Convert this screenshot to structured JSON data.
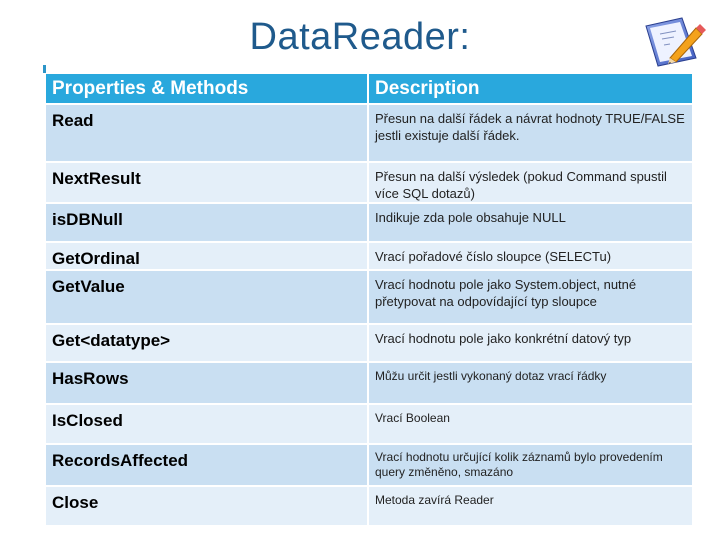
{
  "slide": {
    "title": "DataReader:",
    "icon": "notepad-pencil-icon"
  },
  "table": {
    "headers": [
      "Properties & Methods",
      "Description"
    ],
    "rows": [
      {
        "name": "Read",
        "description": "Přesun na další řádek a návrat hodnoty TRUE/FALSE jestli existuje další řádek."
      },
      {
        "name": "NextResult",
        "description": "Přesun na další výsledek (pokud Command spustil více SQL dotazů)"
      },
      {
        "name": "isDBNull",
        "description": "Indikuje zda pole obsahuje NULL"
      },
      {
        "name": "GetOrdinal",
        "description": "Vrací pořadové číslo sloupce (SELECTu)"
      },
      {
        "name": "GetValue",
        "description": "Vrací hodnotu pole jako System.object, nutné přetypovat na odpovídající typ sloupce"
      },
      {
        "name": "Get<datatype>",
        "description": "Vrací hodnotu pole jako konkrétní datový typ"
      },
      {
        "name": "HasRows",
        "description": "Můžu určit jestli vykonaný dotaz vrací řádky"
      },
      {
        "name": "IsClosed",
        "description": "Vrací Boolean"
      },
      {
        "name": "RecordsAffected",
        "description": "Vrací hodnotu určující kolik záznamů bylo provedením query změněno, smazáno"
      },
      {
        "name": "Close",
        "description": "Metoda zavírá Reader"
      }
    ]
  },
  "colors": {
    "title": "#1f5a8c",
    "header_bg": "#29a8dd",
    "row_dark": "#c9dff2",
    "row_light": "#e4eff9"
  }
}
